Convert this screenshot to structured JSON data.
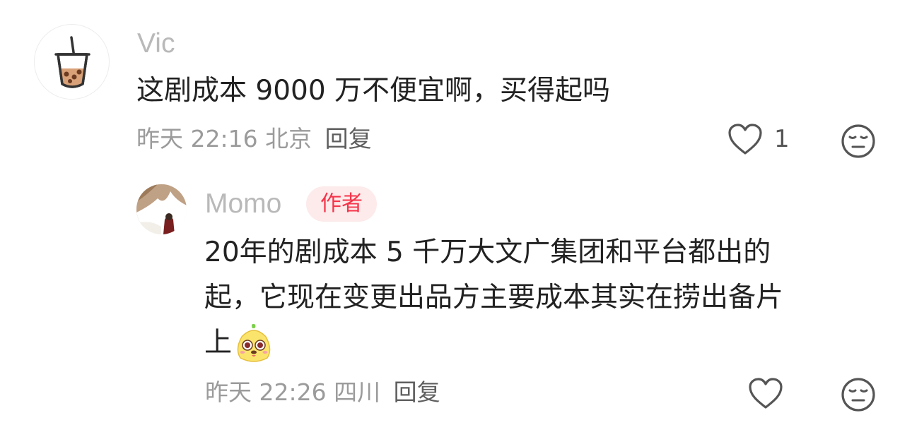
{
  "comments": [
    {
      "avatar_icon": "bubble-tea-icon",
      "username": "Vic",
      "text": "这剧成本 9000 万不便宜啊，买得起吗",
      "time": "昨天 22:16",
      "location": "北京",
      "reply_label": "回复",
      "like_count": "1"
    }
  ],
  "reply": {
    "username": "Momo",
    "author_badge": "作者",
    "text_lines": [
      "20年的剧成本 5 千万大文广集团和平台都出的",
      "起，它现在变更出品方主要成本其实在捞出备片",
      "上"
    ],
    "emoji_icon": "cute-face-emoji-icon",
    "time": "昨天 22:26",
    "location": "四川",
    "reply_label": "回复"
  },
  "colors": {
    "username": "#b9b9b9",
    "body_text": "#222222",
    "meta": "#9b9b9b",
    "badge_bg": "#fdeaea",
    "badge_text": "#f5344a"
  }
}
